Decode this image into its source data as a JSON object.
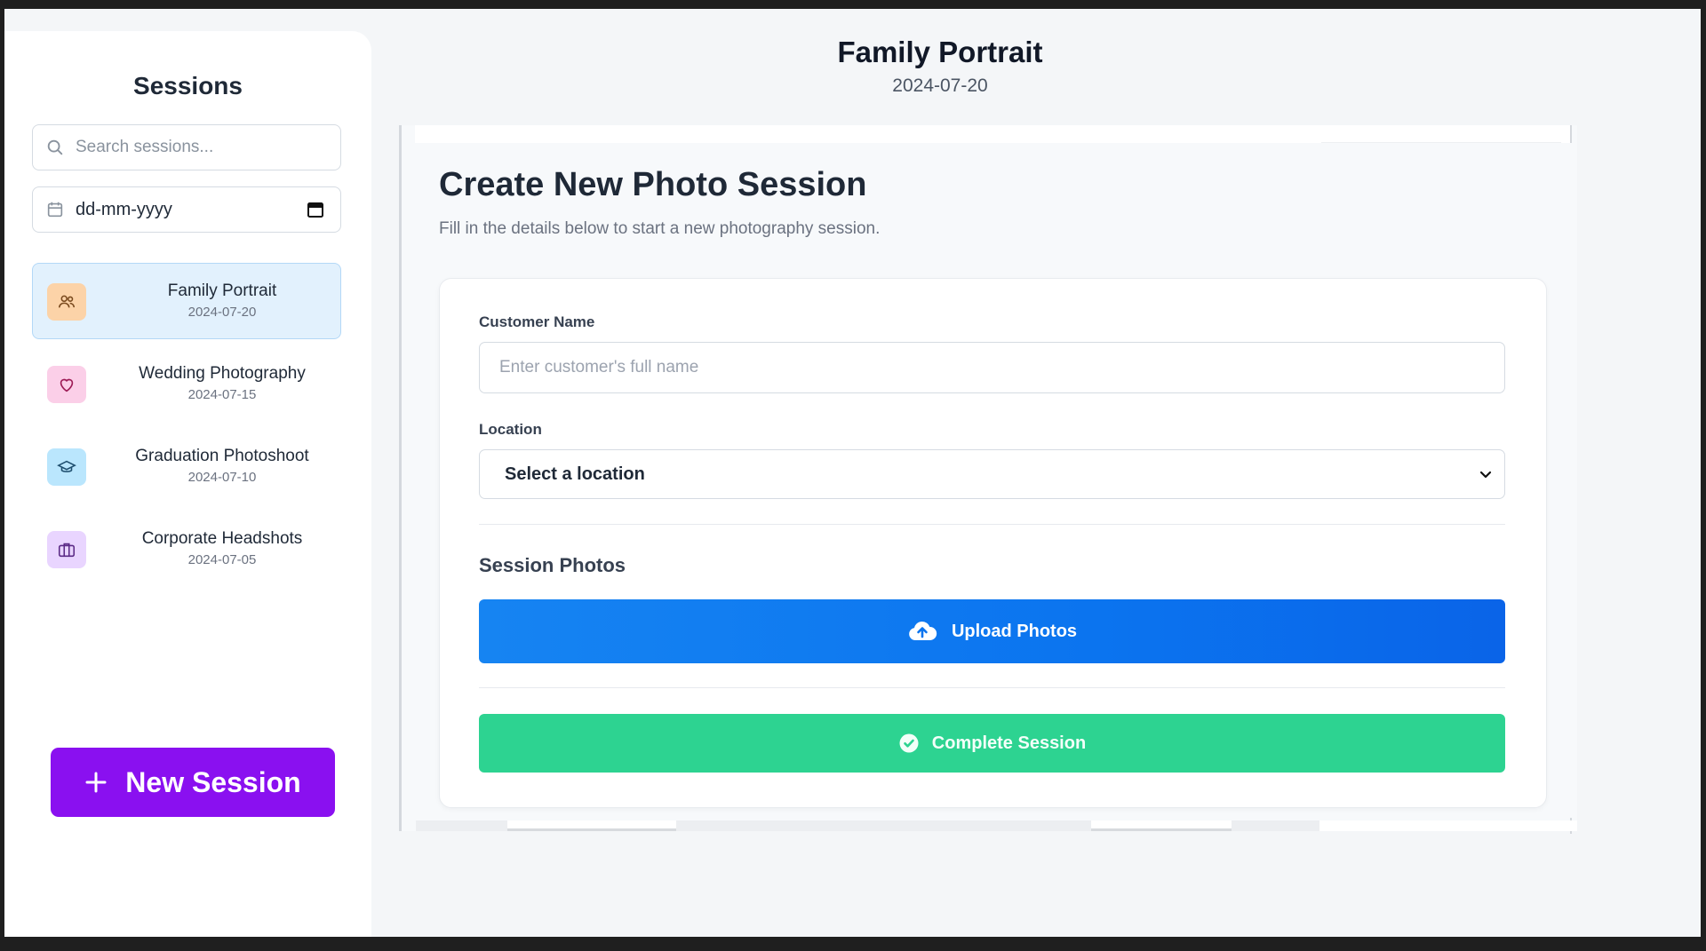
{
  "sidebar": {
    "title": "Sessions",
    "search_placeholder": "Search sessions...",
    "date_placeholder": "dd-mm-yyyy",
    "items": [
      {
        "name": "Family Portrait",
        "date": "2024-07-20",
        "icon": "people-icon",
        "color": "#fcd3a8",
        "active": true
      },
      {
        "name": "Wedding Photography",
        "date": "2024-07-15",
        "icon": "heart-icon",
        "color": "#fbcfe8",
        "active": false
      },
      {
        "name": "Graduation Photoshoot",
        "date": "2024-07-10",
        "icon": "graduation-cap-icon",
        "color": "#bae6fd",
        "active": false
      },
      {
        "name": "Corporate Headshots",
        "date": "2024-07-05",
        "icon": "briefcase-icon",
        "color": "#e9d5ff",
        "active": false
      }
    ],
    "new_session_label": "New Session"
  },
  "header": {
    "title": "Family Portrait",
    "date": "2024-07-20"
  },
  "main": {
    "title": "Create New Photo Session",
    "subtitle": "Fill in the details below to start a new photography session.",
    "form": {
      "customer_label": "Customer Name",
      "customer_placeholder": "Enter customer's full name",
      "location_label": "Location",
      "location_value": "Select a location",
      "photos_label": "Session Photos",
      "upload_label": "Upload Photos",
      "complete_label": "Complete Session"
    }
  },
  "colors": {
    "accent_purple": "#8a10f0",
    "upload_blue": "#0b74ef",
    "complete_green": "#2dd391",
    "active_item_bg": "#e2f1fd"
  }
}
